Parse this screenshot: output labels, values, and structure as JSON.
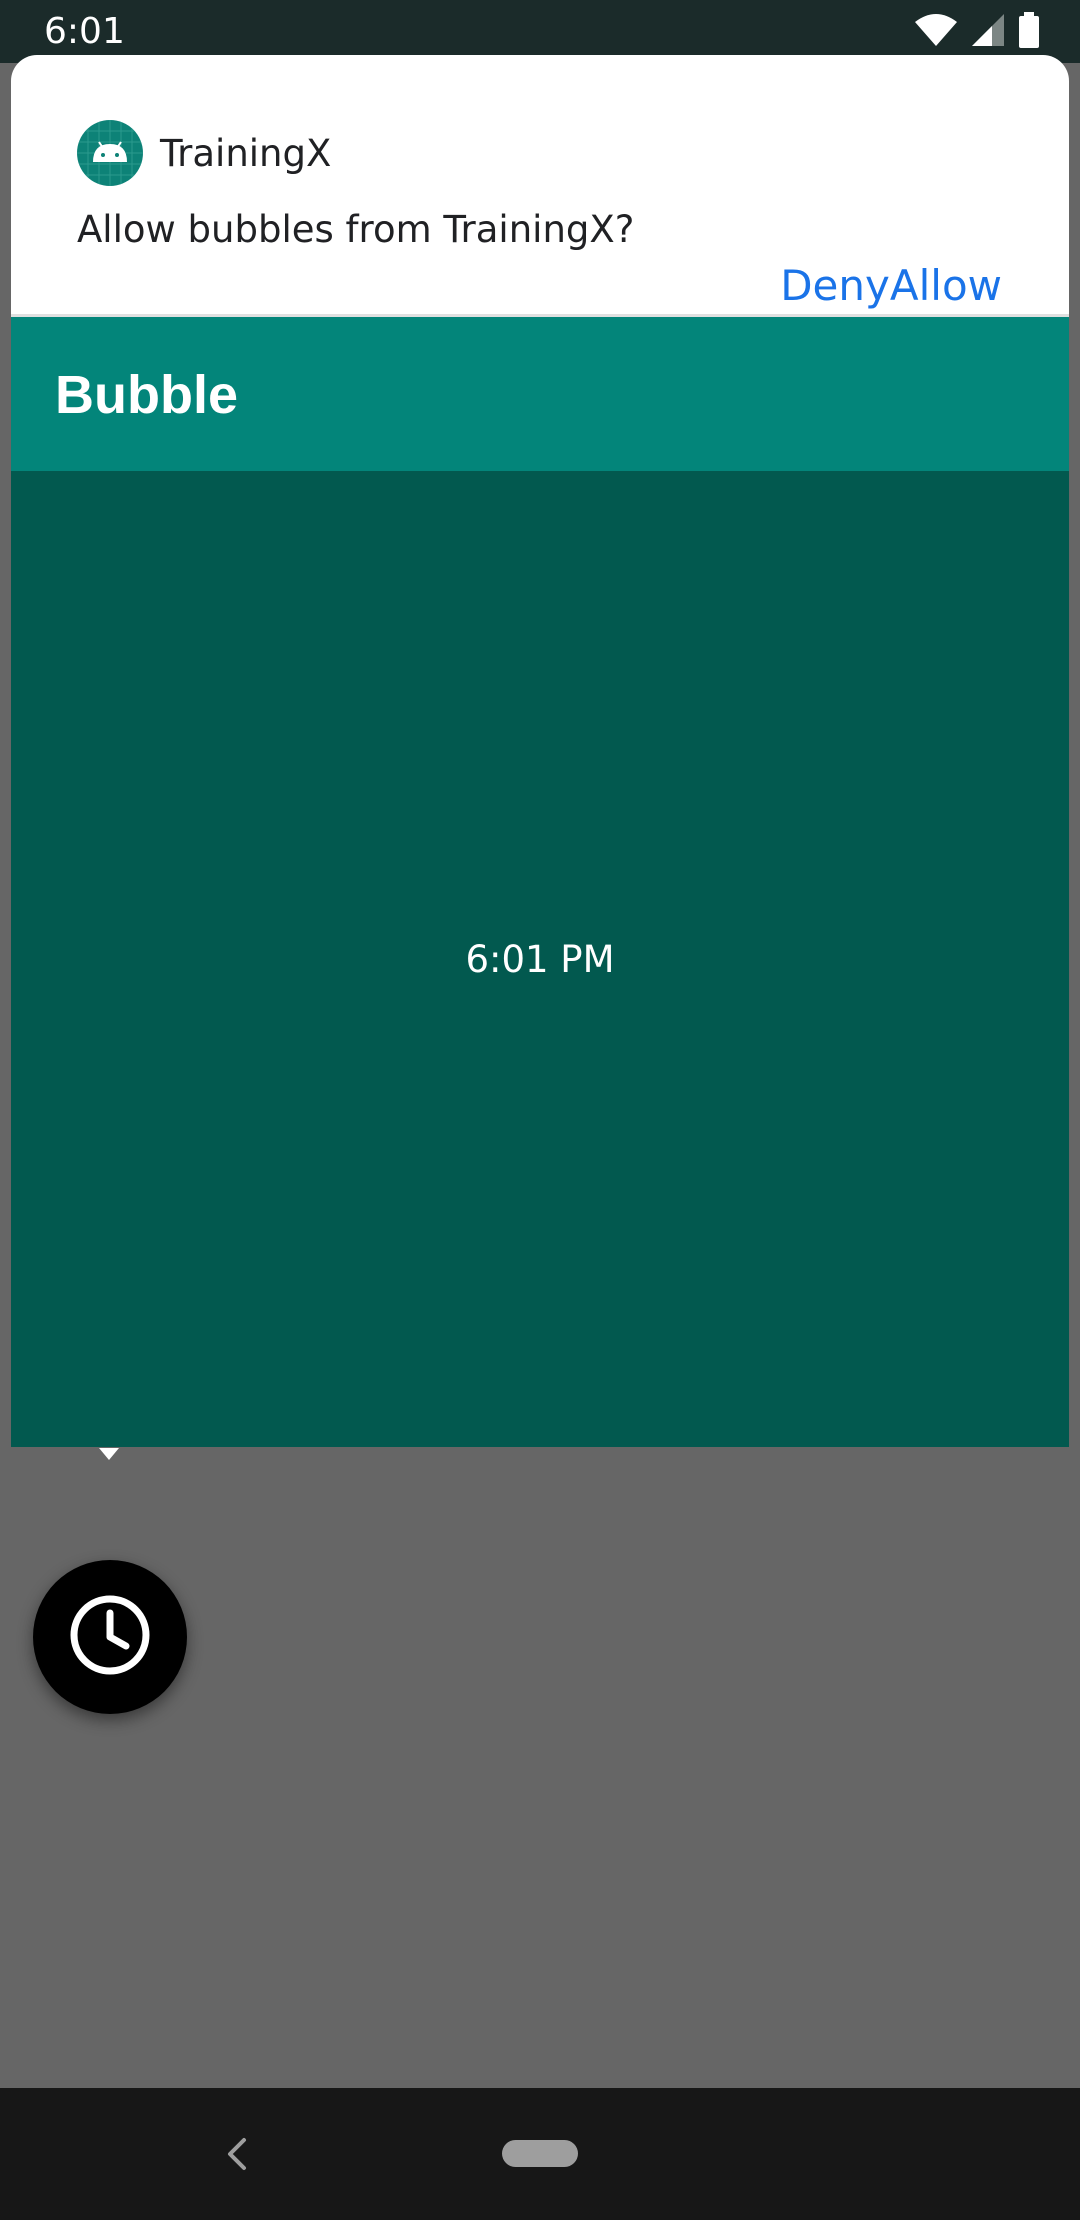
{
  "status_bar": {
    "time": "6:01",
    "icons": [
      "wifi-icon",
      "cell-signal-icon",
      "battery-icon"
    ]
  },
  "permission": {
    "app_name": "TrainingX",
    "app_icon": "android-icon",
    "question": "Allow bubbles from TrainingX?",
    "deny_label": "Deny",
    "allow_label": "Allow"
  },
  "bubble": {
    "title": "Bubble",
    "time_text": "6:01 PM",
    "fab_icon": "clock-icon"
  },
  "nav_bar": {
    "icons": [
      "back-icon",
      "home-pill"
    ]
  },
  "colors": {
    "status_bar": "#1b2b2a",
    "toolbar": "#03857a",
    "bubble_body": "#02594f",
    "backdrop": "#666666",
    "action_text": "#1a73e8",
    "nav_bar": "#171717"
  }
}
